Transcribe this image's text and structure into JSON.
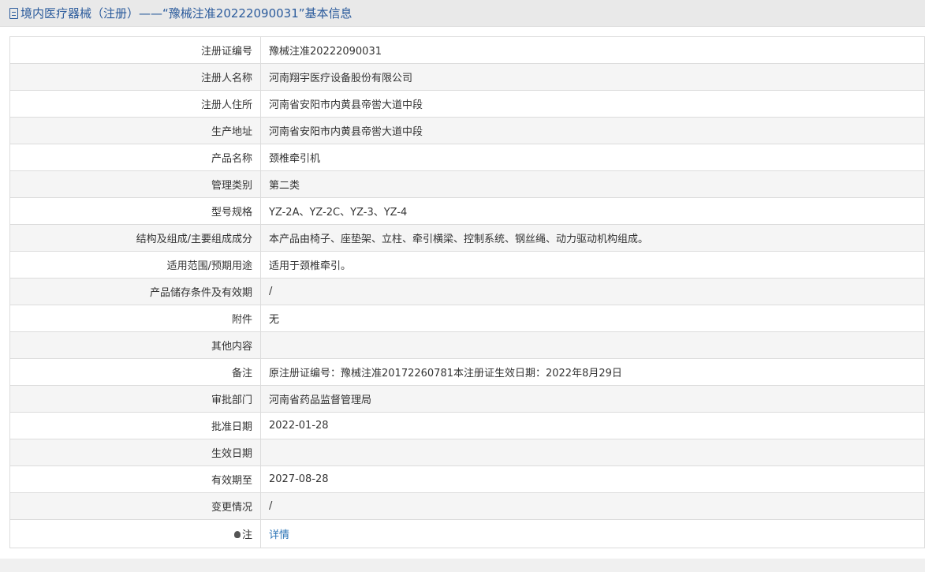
{
  "header": {
    "title": "境内医疗器械（注册）——“豫械注准20222090031”基本信息",
    "icon": "document-icon"
  },
  "rows": [
    {
      "label": "注册证编号",
      "value": "豫械注准20222090031"
    },
    {
      "label": "注册人名称",
      "value": "河南翔宇医疗设备股份有限公司"
    },
    {
      "label": "注册人住所",
      "value": "河南省安阳市内黄县帝喾大道中段"
    },
    {
      "label": "生产地址",
      "value": "河南省安阳市内黄县帝喾大道中段"
    },
    {
      "label": "产品名称",
      "value": "颈椎牵引机"
    },
    {
      "label": "管理类别",
      "value": "第二类"
    },
    {
      "label": "型号规格",
      "value": "YZ-2A、YZ-2C、YZ-3、YZ-4"
    },
    {
      "label": "结构及组成/主要组成成分",
      "value": "本产品由椅子、座垫架、立柱、牵引横梁、控制系统、钢丝绳、动力驱动机构组成。"
    },
    {
      "label": "适用范围/预期用途",
      "value": "适用于颈椎牵引。"
    },
    {
      "label": "产品储存条件及有效期",
      "value": "/"
    },
    {
      "label": "附件",
      "value": "无"
    },
    {
      "label": "其他内容",
      "value": ""
    },
    {
      "label": "备注",
      "value": "原注册证编号：豫械注准20172260781本注册证生效日期：2022年8月29日"
    },
    {
      "label": "审批部门",
      "value": "河南省药品监督管理局"
    },
    {
      "label": "批准日期",
      "value": "2022-01-28"
    },
    {
      "label": "生效日期",
      "value": ""
    },
    {
      "label": "有效期至",
      "value": "2027-08-28"
    },
    {
      "label": "变更情况",
      "value": "/"
    }
  ],
  "note_row": {
    "label": "注",
    "icon": "lightbulb-icon",
    "link_text": "详情"
  },
  "colors": {
    "title": "#2b5b9c",
    "link": "#2b74b6",
    "row_alt": "#f5f5f5",
    "border": "#dcdcdc"
  }
}
